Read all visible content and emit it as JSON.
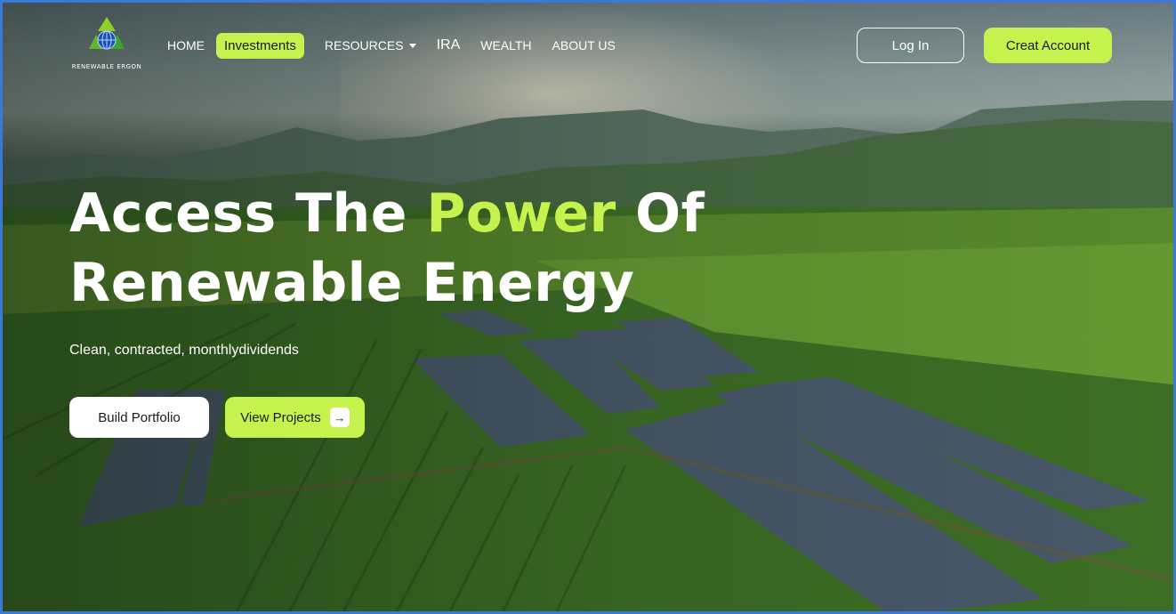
{
  "logo": {
    "text": "RENEWABLE ERGON",
    "icon": "recycle-globe-icon"
  },
  "nav": {
    "items": [
      {
        "label": "HOME"
      },
      {
        "label": "Investments"
      },
      {
        "label": "RESOURCES"
      },
      {
        "label": "IRA"
      },
      {
        "label": "WEALTH"
      },
      {
        "label": "ABOUT US"
      }
    ],
    "active_index": 1,
    "login_label": "Log In",
    "create_label": "Creat Account"
  },
  "hero": {
    "title_part1": "Access The ",
    "title_accent": "Power",
    "title_part2": " Of",
    "title_line2": "Renewable Energy",
    "subtitle": "Clean, contracted, monthlydividends",
    "build_label": "Build Portfolio",
    "view_label": "View Projects",
    "view_icon": "arrow-right-icon"
  },
  "colors": {
    "accent": "#c6f24e",
    "frame_border": "#3b78d8"
  }
}
